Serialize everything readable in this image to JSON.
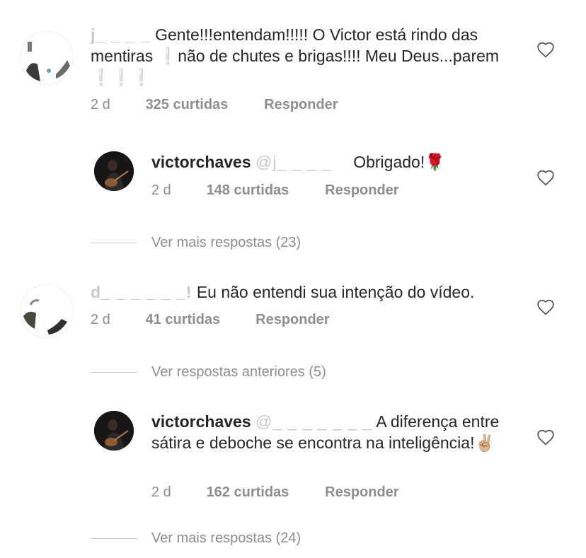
{
  "comments": [
    {
      "username_masked": "j_ _ _ _",
      "text": "Gente!!!entendam!!!!! O Victor está rindo das mentiras ❕não de chutes e brigas!!!! Meu Deus...parem ❕❕❕",
      "time": "2 d",
      "likes": "325 curtidas",
      "reply": "Responder",
      "replies": [
        {
          "username": "victorchaves",
          "mention": "@j_ _ _ _",
          "text": "Obrigado!🌹",
          "time": "2 d",
          "likes": "148 curtidas",
          "reply": "Responder"
        }
      ],
      "thread_link": "Ver mais respostas (23)"
    },
    {
      "username_masked": "d_ _ _ _ _ _!",
      "text": "Eu não entendi sua intenção do vídeo.",
      "time": "2 d",
      "likes": "41 curtidas",
      "reply": "Responder",
      "thread_link_prev": "Ver respostas anteriores (5)",
      "replies": [
        {
          "username": "victorchaves",
          "mention": "@_ _ _ _ _ _ _",
          "text": "A diferença entre sátira e deboche se encontra na inteligência!✌🏼",
          "time": "2 d",
          "likes": "162 curtidas",
          "reply": "Responder"
        }
      ],
      "thread_link": "Ver mais respostas (24)"
    }
  ]
}
